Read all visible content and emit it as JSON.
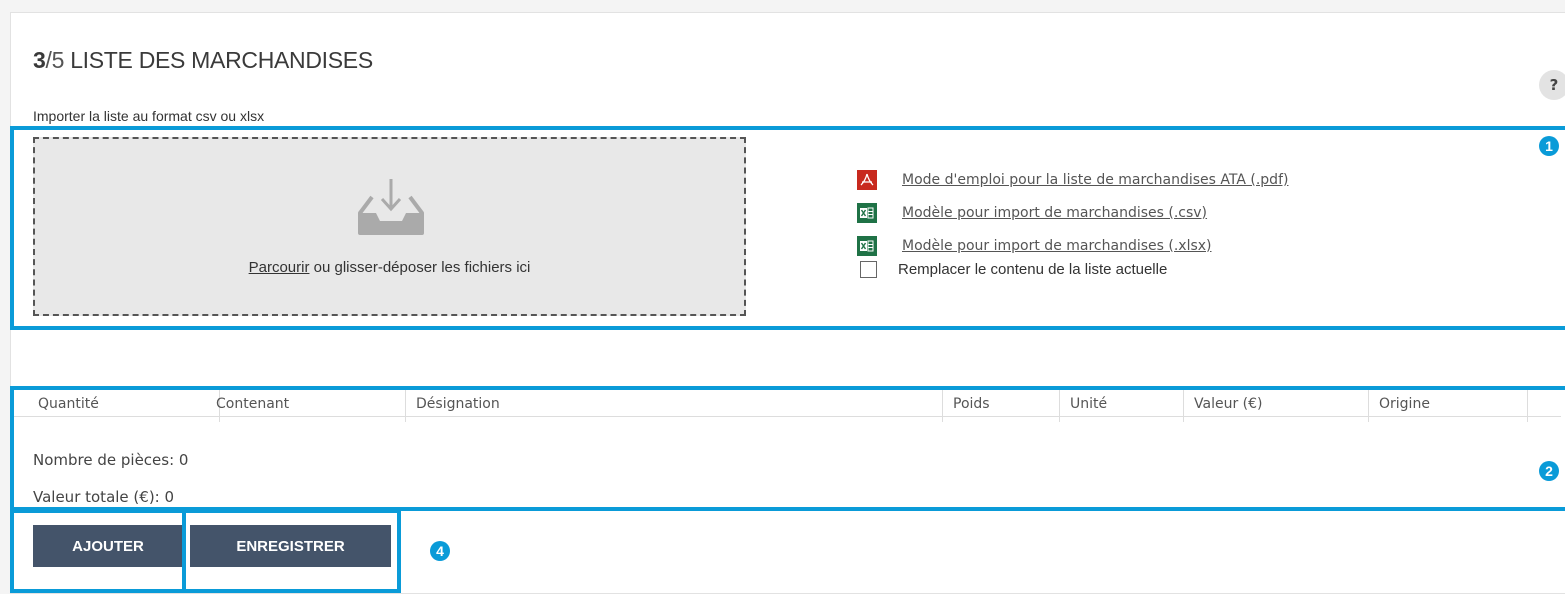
{
  "header": {
    "step": "3",
    "total": "/5",
    "title": "LISTE DES MARCHANDISES",
    "help_label": "?"
  },
  "import": {
    "label": "Importer la liste au format csv ou xlsx",
    "browse_link": "Parcourir",
    "drop_text": " ou glisser-déposer les fichiers ici"
  },
  "downloads": [
    {
      "icon": "pdf-icon",
      "label": "Mode d'emploi pour la liste de marchandises ATA (.pdf)"
    },
    {
      "icon": "excel-icon",
      "label": "Modèle pour import de marchandises (.csv)"
    },
    {
      "icon": "excel-icon",
      "label": "Modèle pour import de marchandises (.xlsx)"
    }
  ],
  "replace_checkbox": {
    "label": "Remplacer le contenu de la liste actuelle",
    "checked": false
  },
  "table": {
    "columns": [
      "Quantité",
      "Contenant",
      "Désignation",
      "Poids",
      "Unité",
      "Valeur (€)",
      "Origine"
    ]
  },
  "summary": {
    "pieces": "Nombre de pièces: 0",
    "total_value": "Valeur totale (€): 0"
  },
  "actions": {
    "add_label": "AJOUTER",
    "save_label": "ENREGISTRER"
  },
  "annotations": {
    "badge1": "1",
    "badge2": "2",
    "badge4": "4"
  },
  "colors": {
    "highlight": "#0a9bd8",
    "button_bg": "#44546a",
    "pdf_icon": "#c8291e",
    "excel_icon": "#1f7246"
  }
}
